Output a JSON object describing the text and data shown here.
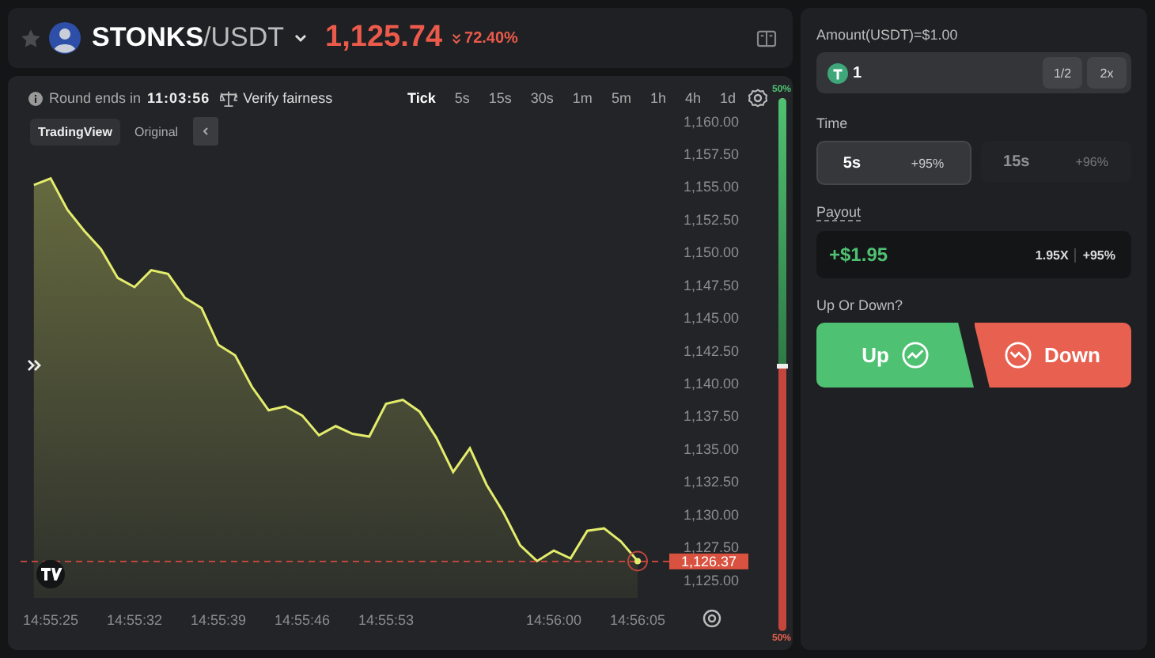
{
  "header": {
    "favorite": false,
    "pair_base": "STONKS",
    "pair_quote": "/USDT",
    "price": "1,125.74",
    "change": "72.40%"
  },
  "round": {
    "label": "Round ends in",
    "time": "11:03:56",
    "verify": "Verify fairness"
  },
  "intervals": [
    {
      "label": "Tick",
      "selected": true
    },
    {
      "label": "5s",
      "selected": false
    },
    {
      "label": "15s",
      "selected": false
    },
    {
      "label": "30s",
      "selected": false
    },
    {
      "label": "1m",
      "selected": false
    },
    {
      "label": "5m",
      "selected": false
    },
    {
      "label": "1h",
      "selected": false
    },
    {
      "label": "4h",
      "selected": false
    },
    {
      "label": "1d",
      "selected": false
    }
  ],
  "chart_views": [
    {
      "label": "TradingView",
      "selected": true
    },
    {
      "label": "Original",
      "selected": false
    }
  ],
  "chart": {
    "chart_data": {
      "type": "area",
      "ylim": [
        1125,
        1160
      ],
      "ref_lines": [
        {
          "axis": "y",
          "value": 1126.37,
          "label": "1,126.37",
          "color": "#c0463d"
        }
      ],
      "categories": [
        null,
        "14:55:25",
        null,
        null,
        null,
        null,
        "14:55:32",
        null,
        null,
        null,
        null,
        "14:55:39",
        null,
        null,
        null,
        null,
        "14:55:46",
        null,
        null,
        null,
        null,
        "14:55:53",
        null,
        null,
        null,
        null,
        null,
        null,
        null,
        null,
        null,
        "14:56:00",
        null,
        null,
        null,
        null,
        "14:56:05"
      ],
      "series": [
        {
          "color": "#e4ec6c",
          "values": [
            1155.1,
            1155.6,
            1153.2,
            1151.6,
            1150.2,
            1148.0,
            1147.3,
            1148.6,
            1148.3,
            1146.5,
            1145.7,
            1142.9,
            1142.1,
            1139.7,
            1137.9,
            1138.2,
            1137.5,
            1136.0,
            1136.7,
            1136.1,
            1135.9,
            1138.4,
            1138.7,
            1137.8,
            1135.8,
            1133.2,
            1135.0,
            1132.2,
            1130.1,
            1127.6,
            1126.4,
            1127.2,
            1126.6,
            1128.7,
            1128.9,
            1127.9,
            1126.4
          ]
        }
      ],
      "yticks": [
        {
          "value": 1160,
          "label": "1,160.00"
        },
        {
          "value": 1157.5,
          "label": "1,157.50"
        },
        {
          "value": 1155,
          "label": "1,155.00"
        },
        {
          "value": 1152.5,
          "label": "1,152.50"
        },
        {
          "value": 1150,
          "label": "1,150.00"
        },
        {
          "value": 1147.5,
          "label": "1,147.50"
        },
        {
          "value": 1145,
          "label": "1,145.00"
        },
        {
          "value": 1142.5,
          "label": "1,142.50"
        },
        {
          "value": 1140,
          "label": "1,140.00"
        },
        {
          "value": 1137.5,
          "label": "1,137.50"
        },
        {
          "value": 1135,
          "label": "1,135.00"
        },
        {
          "value": 1132.5,
          "label": "1,132.50"
        },
        {
          "value": 1130,
          "label": "1,130.00"
        },
        {
          "value": 1127.5,
          "label": "1,127.50"
        },
        {
          "value": 1125,
          "label": "1,125.00"
        }
      ]
    }
  },
  "sentiment": {
    "level": 0.5,
    "up_label": "50%",
    "down_label": "50%"
  },
  "trade": {
    "amount_label": "Amount(USDT)=$1.00",
    "amount_value": "1",
    "half": "1/2",
    "double": "2x",
    "time_label": "Time",
    "time_options": [
      {
        "duration": "5s",
        "bonus": "+95%",
        "selected": true
      },
      {
        "duration": "15s",
        "bonus": "+96%",
        "selected": false
      }
    ],
    "payout_label": "Payout",
    "payout": "+$1.95",
    "multiplier": "1.95X",
    "payout_bonus": "+95%",
    "direction_label": "Up Or Down?",
    "up": "Up",
    "down": "Down"
  }
}
